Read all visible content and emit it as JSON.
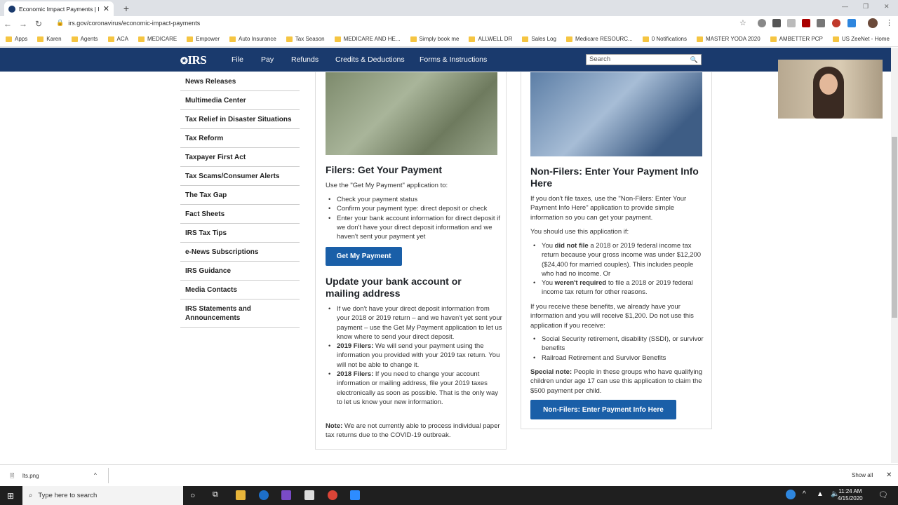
{
  "browser": {
    "tab_title": "Economic Impact Payments | Inte",
    "url": "irs.gov/coronavirus/economic-impact-payments",
    "bookmarks": [
      "Apps",
      "Karen",
      "Agents",
      "ACA",
      "MEDICARE",
      "Empower",
      "Auto Insurance",
      "Tax Season",
      "MEDICARE AND HE...",
      "Simply book me",
      "ALLWELL DR",
      "Sales Log",
      "Medicare RESOURC...",
      "0 Notifications",
      "MASTER YODA 2020",
      "AMBETTER PCP",
      "US ZeeNet - Home"
    ]
  },
  "irs": {
    "logo": "IRS",
    "menu": [
      "File",
      "Pay",
      "Refunds",
      "Credits & Deductions",
      "Forms & Instructions"
    ],
    "search_placeholder": "Search"
  },
  "sidebar": [
    "News Releases",
    "Multimedia Center",
    "Tax Relief in Disaster Situations",
    "Tax Reform",
    "Taxpayer First Act",
    "Tax Scams/Consumer Alerts",
    "The Tax Gap",
    "Fact Sheets",
    "IRS Tax Tips",
    "e-News Subscriptions",
    "IRS Guidance",
    "Media Contacts",
    "IRS Statements and Announcements"
  ],
  "filers": {
    "title": "Filers: Get Your Payment",
    "intro": "Use the \"Get My Payment\" application to:",
    "bullets": [
      "Check your payment status",
      "Confirm your payment type: direct deposit or check",
      "Enter your bank account information for direct deposit if we don't have your direct deposit information and we haven't sent your payment yet"
    ],
    "button": "Get My Payment",
    "update_title": "Update your bank account or mailing address",
    "update_b1": "If we don't have your direct deposit information from your 2018 or 2019 return – and we haven't yet sent your payment – use the Get My Payment application to let us know where to send your direct deposit.",
    "update_b2_label": "2019 Filers:",
    "update_b2": " We will send your payment using the information you provided with your 2019 tax return. You will not be able to change it.",
    "update_b3_label": "2018 Filers:",
    "update_b3": " If you need to change your account information or mailing address, file your 2019 taxes electronically as soon as possible. That is the only way to let us know your new information.",
    "note_label": "Note:",
    "note": " We are not currently able to process individual paper tax returns due to the COVID-19 outbreak."
  },
  "nonfilers": {
    "title": "Non-Filers: Enter Your Payment Info Here",
    "intro": "If you don't file taxes, use the \"Non-Filers: Enter Your Payment Info Here\" application to provide simple information so you can get your payment.",
    "should": "You should use this application if:",
    "b1_pre": "You ",
    "b1_bold": "did not file",
    "b1_post": " a 2018 or 2019 federal income tax return because your gross income was under $12,200 ($24,400 for married couples). This includes people who had no income. Or",
    "b2_pre": "You ",
    "b2_bold": "weren't required",
    "b2_post": " to file a 2018 or 2019 federal income tax return for other reasons.",
    "benefits": "If you receive these benefits, we already have your information and you will receive $1,200. Do not use this application if you receive:",
    "benefit_items": [
      "Social Security retirement, disability (SSDI), or survivor benefits",
      "Railroad Retirement and Survivor Benefits"
    ],
    "special_label": "Special note:",
    "special": " People in these groups who have qualifying children under age 17 can use this application to claim the $500 payment per child.",
    "button": "Non-Filers: Enter Payment Info Here"
  },
  "download": {
    "file": "lts.png",
    "show_all": "Show all"
  },
  "taskbar": {
    "search": "Type here to search",
    "time": "11:24 AM",
    "date": "4/15/2020"
  }
}
